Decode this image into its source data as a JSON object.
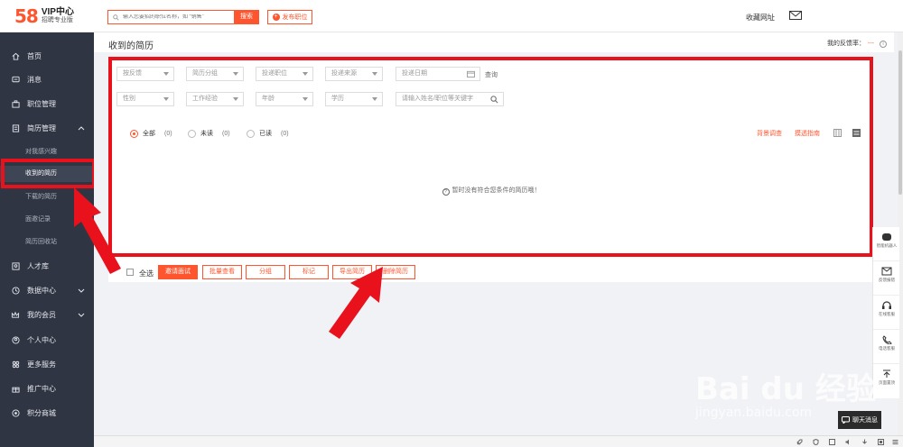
{
  "header": {
    "logo_num": "58",
    "logo_title": "VIP中心",
    "logo_sub": "招聘专业版",
    "search_placeholder": "输入您要招的职位名称，如 “销售”",
    "search_button": "搜索",
    "post_button": "发布职位",
    "favorites": "收藏网址"
  },
  "sidebar": {
    "items": [
      {
        "label": "首页",
        "icon": "home-icon"
      },
      {
        "label": "消息",
        "icon": "message-icon"
      },
      {
        "label": "职位管理",
        "icon": "briefcase-icon"
      },
      {
        "label": "简历管理",
        "icon": "resume-icon"
      },
      {
        "label": "人才库",
        "icon": "talent-icon"
      },
      {
        "label": "数据中心",
        "icon": "data-icon"
      },
      {
        "label": "我的会员",
        "icon": "crown-icon"
      },
      {
        "label": "个人中心",
        "icon": "user-icon"
      },
      {
        "label": "更多服务",
        "icon": "grid-icon"
      },
      {
        "label": "推广中心",
        "icon": "gift-icon"
      },
      {
        "label": "积分商城",
        "icon": "points-icon"
      }
    ],
    "resume_sub": [
      {
        "label": "对我感兴趣"
      },
      {
        "label": "收到的简历"
      },
      {
        "label": "下载的简历"
      },
      {
        "label": "面邀记录"
      },
      {
        "label": "简历回收站"
      }
    ]
  },
  "main": {
    "title": "收到的简历",
    "feedback_rate_label": "我的反馈率：",
    "feedback_rate_value": "---",
    "info_glyph": "i",
    "filters_row1": [
      "按反馈",
      "简历分组",
      "投递职位",
      "投递来源"
    ],
    "date_placeholder": "投递日期",
    "query": "查询",
    "filters_row2": [
      "性别",
      "工作经验",
      "年龄",
      "学历"
    ],
    "keyword_placeholder": "请输入姓名/职位等关键字",
    "tabs": [
      {
        "label": "全部",
        "count": "(0)"
      },
      {
        "label": "未读",
        "count": "(0)"
      },
      {
        "label": "已读",
        "count": "(0)"
      }
    ],
    "link_background": "背景调查",
    "link_guide": "摸透指南",
    "empty_text": "暂时没有符合您条件的简历哦！",
    "select_all": "全选",
    "actions": [
      "邀请面试",
      "批量查看",
      "分组",
      "标记",
      "导出简历",
      "删除简历"
    ]
  },
  "right_tools": [
    {
      "label": "智能机器人"
    },
    {
      "label": "反馈报错"
    },
    {
      "label": "在线客服"
    },
    {
      "label": "电话客服"
    },
    {
      "label": "页面置顶"
    }
  ],
  "chat_button": "聊天消息",
  "watermark": "Bai du 经验",
  "watermark_url": "jingyan.baidu.com",
  "colors": {
    "accent": "#ff552e",
    "sidebar": "#2f3543",
    "annotation": "#e8111c"
  }
}
